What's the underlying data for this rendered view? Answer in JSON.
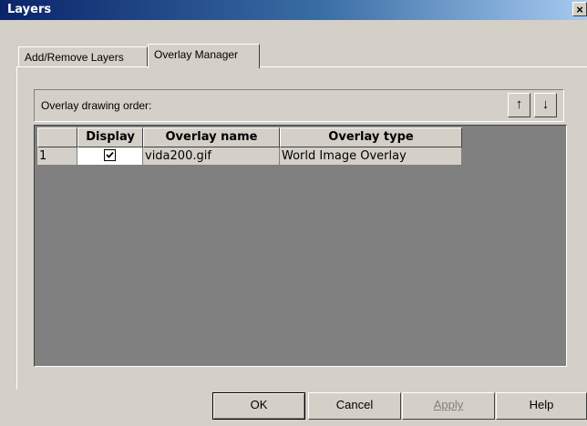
{
  "window": {
    "title": "Layers",
    "close_label": "×"
  },
  "tabs": [
    {
      "label": "Add/Remove Layers",
      "active": false
    },
    {
      "label": "Overlay Manager",
      "active": true
    }
  ],
  "overlay_manager": {
    "order_label": "Overlay drawing order:",
    "move_up_icon": "arrow-up-icon",
    "move_down_icon": "arrow-down-icon",
    "up_glyph": "↑",
    "down_glyph": "↓",
    "columns": [
      "",
      "Display",
      "Overlay name",
      "Overlay type"
    ],
    "rows": [
      {
        "index": "1",
        "display_checked": true,
        "name": "vida200.gif",
        "type": "World Image Overlay"
      }
    ]
  },
  "buttons": {
    "ok": "OK",
    "cancel": "Cancel",
    "apply": "Apply",
    "apply_enabled": false,
    "help": "Help"
  }
}
